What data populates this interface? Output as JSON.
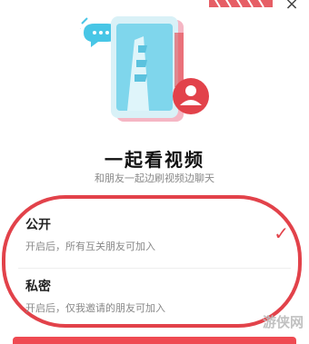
{
  "header": {
    "close_icon": "close-icon"
  },
  "illustration": {
    "icons": [
      "chat-bubble-icon",
      "video-card-icon",
      "user-avatar-icon"
    ],
    "colors": {
      "accent": "#e2424a",
      "cyan": "#48c6e6",
      "pink": "#f5b6c4"
    }
  },
  "title": "一起看视频",
  "subtitle": "和朋友一起边刷视频边聊天",
  "options": [
    {
      "label": "公开",
      "description": "开启后，所有互关朋友可加入",
      "selected": true
    },
    {
      "label": "私密",
      "description": "开启后，仅我邀请的朋友可加入",
      "selected": false
    }
  ],
  "watermark": "游侠网",
  "colors": {
    "accent": "#e2424a",
    "text": "#222222",
    "muted": "#888888"
  }
}
